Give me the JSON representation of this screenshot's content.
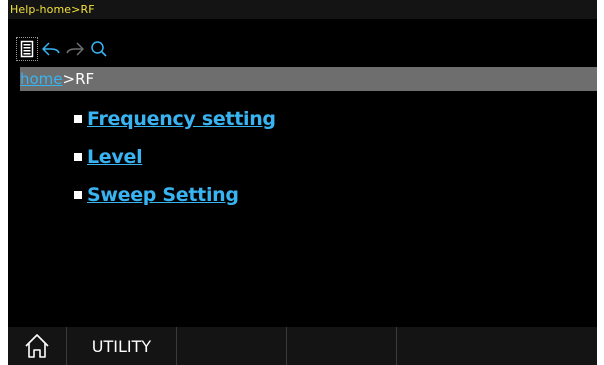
{
  "window": {
    "title": "Help-home>RF"
  },
  "toolbar": {
    "items": [
      {
        "icon": "document-icon"
      },
      {
        "icon": "back-arrow-icon"
      },
      {
        "icon": "forward-arrow-icon"
      },
      {
        "icon": "search-icon"
      }
    ]
  },
  "breadcrumb": {
    "home": "home",
    "separator": ">",
    "current": "RF"
  },
  "topics": [
    {
      "label": "Frequency setting"
    },
    {
      "label": "Level"
    },
    {
      "label": "Sweep Setting"
    }
  ],
  "softkeys": {
    "home_icon": "home-icon",
    "labels": [
      "UTILITY",
      "",
      "",
      ""
    ]
  },
  "colors": {
    "title_text": "#f2e23a",
    "link": "#38b4f2",
    "breadcrumb_bg": "#6e6e6e",
    "background": "#000000"
  }
}
